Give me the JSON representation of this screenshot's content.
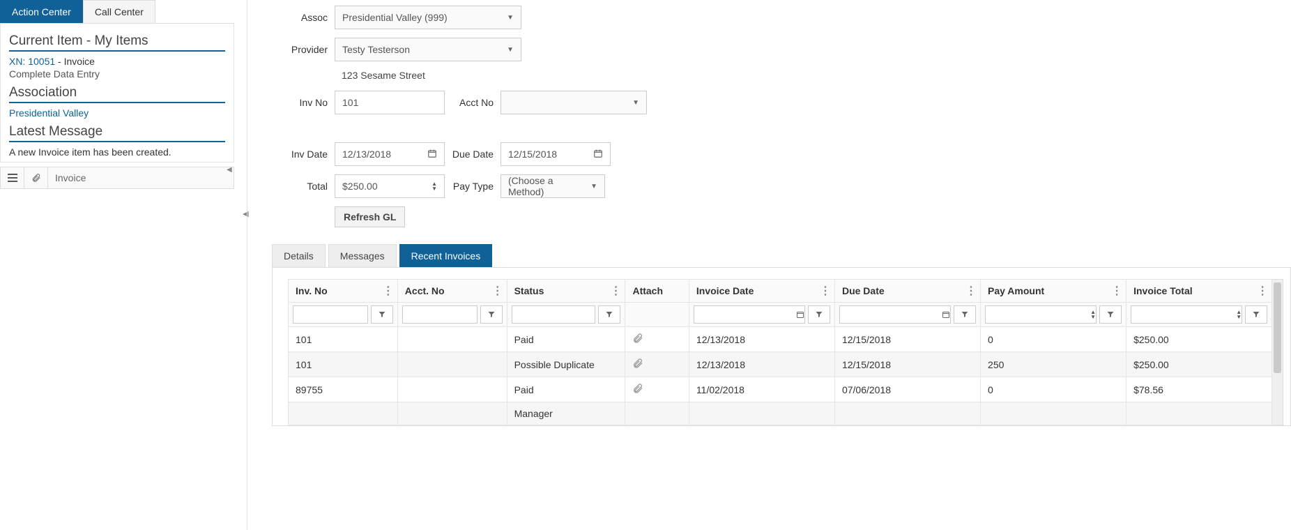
{
  "left": {
    "tabs": [
      "Action Center",
      "Call Center"
    ],
    "heading_current": "Current Item - My Items",
    "xn_label": "XN: 10051",
    "xn_suffix": " - Invoice",
    "status_line": "Complete Data Entry",
    "heading_assoc": "Association",
    "assoc_link": "Presidential Valley",
    "heading_msg": "Latest Message",
    "msg_text": "A new Invoice item has been created.",
    "toolbar_label": "Invoice"
  },
  "form": {
    "assoc_label": "Assoc",
    "assoc_value": "Presidential Valley (999)",
    "provider_label": "Provider",
    "provider_value": "Testy Testerson",
    "provider_addr": "123 Sesame Street",
    "invno_label": "Inv No",
    "invno_value": "101",
    "acctno_label": "Acct No",
    "acctno_value": "",
    "invdate_label": "Inv Date",
    "invdate_value": "12/13/2018",
    "duedate_label": "Due Date",
    "duedate_value": "12/15/2018",
    "total_label": "Total",
    "total_value": "$250.00",
    "paytype_label": "Pay Type",
    "paytype_value": "(Choose a Method)",
    "refresh_btn": "Refresh GL"
  },
  "tabs": [
    "Details",
    "Messages",
    "Recent Invoices"
  ],
  "table": {
    "headers": [
      "Inv. No",
      "Acct. No",
      "Status",
      "Attach",
      "Invoice Date",
      "Due Date",
      "Pay Amount",
      "Invoice Total"
    ],
    "rows": [
      {
        "invno": "101",
        "acct": "",
        "status": "Paid",
        "invdate": "12/13/2018",
        "due": "12/15/2018",
        "pay": "0",
        "total": "$250.00"
      },
      {
        "invno": "101",
        "acct": "",
        "status": "Possible Duplicate",
        "invdate": "12/13/2018",
        "due": "12/15/2018",
        "pay": "250",
        "total": "$250.00"
      },
      {
        "invno": "89755",
        "acct": "",
        "status": "Paid",
        "invdate": "11/02/2018",
        "due": "07/06/2018",
        "pay": "0",
        "total": "$78.56"
      },
      {
        "invno": "",
        "acct": "",
        "status": "Manager",
        "invdate": "",
        "due": "",
        "pay": "",
        "total": ""
      }
    ]
  }
}
